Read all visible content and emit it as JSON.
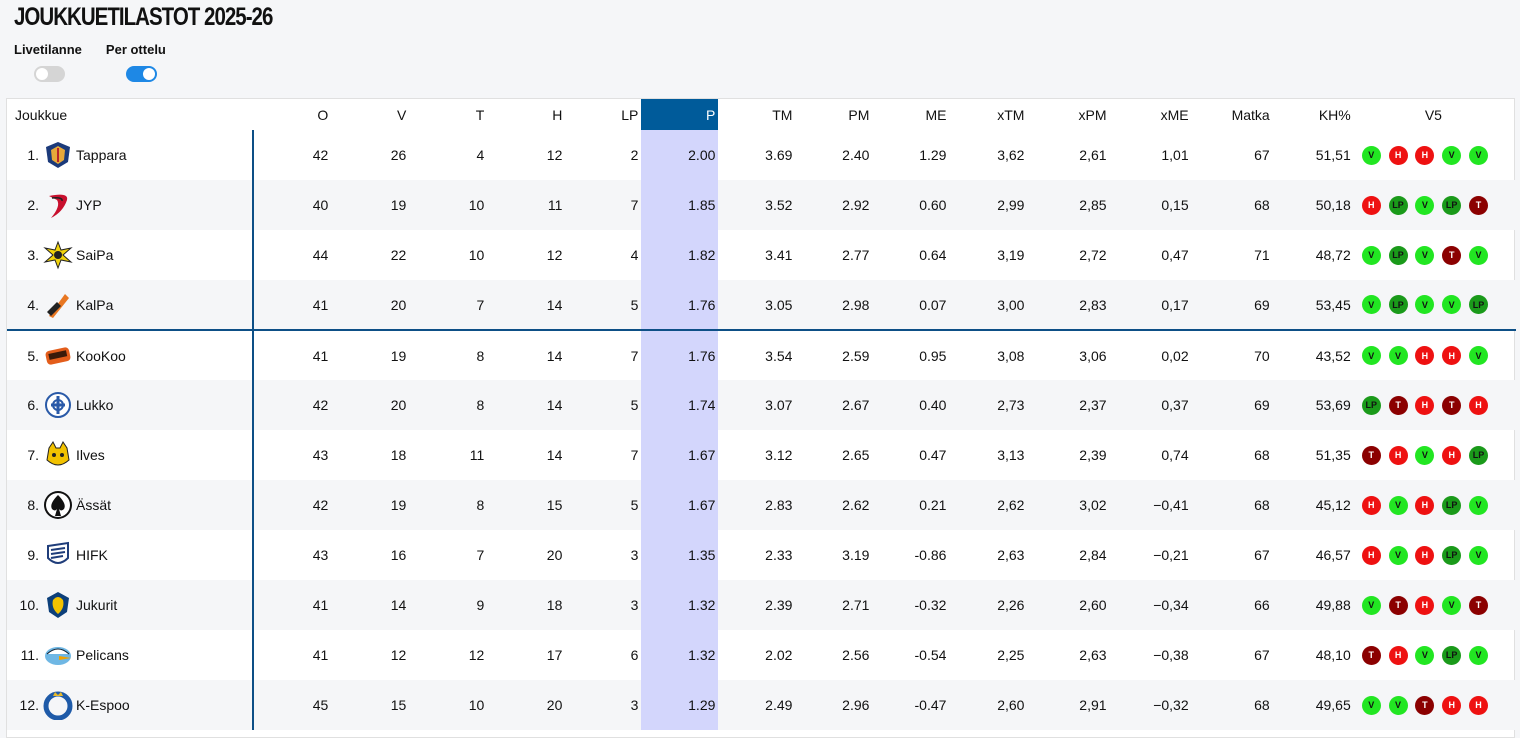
{
  "title": "JOUKKUETILASTOT 2025-26",
  "toggles": [
    {
      "label": "Livetilanne",
      "on": false
    },
    {
      "label": "Per ottelu",
      "on": true
    }
  ],
  "columns": [
    "Joukkue",
    "O",
    "V",
    "T",
    "H",
    "LP",
    "P",
    "TM",
    "PM",
    "ME",
    "xTM",
    "xPM",
    "xME",
    "Matka",
    "KH%",
    "V5"
  ],
  "active_column": "P",
  "rows": [
    {
      "rank": "1.",
      "team": "Tappara",
      "logo": "tappara-logo",
      "O": "42",
      "V": "26",
      "T": "4",
      "H": "12",
      "LP": "2",
      "P": "2.00",
      "TM": "3.69",
      "PM": "2.40",
      "ME": "1.29",
      "xTM": "3,62",
      "xPM": "2,61",
      "xME": "1,01",
      "Matka": "67",
      "KH": "51,51",
      "V5": [
        "V",
        "H",
        "H",
        "V",
        "V"
      ]
    },
    {
      "rank": "2.",
      "team": "JYP",
      "logo": "jyp-logo",
      "O": "40",
      "V": "19",
      "T": "10",
      "H": "11",
      "LP": "7",
      "P": "1.85",
      "TM": "3.52",
      "PM": "2.92",
      "ME": "0.60",
      "xTM": "2,99",
      "xPM": "2,85",
      "xME": "0,15",
      "Matka": "68",
      "KH": "50,18",
      "V5": [
        "H",
        "LP",
        "V",
        "LP",
        "T"
      ]
    },
    {
      "rank": "3.",
      "team": "SaiPa",
      "logo": "saipa-logo",
      "O": "44",
      "V": "22",
      "T": "10",
      "H": "12",
      "LP": "4",
      "P": "1.82",
      "TM": "3.41",
      "PM": "2.77",
      "ME": "0.64",
      "xTM": "3,19",
      "xPM": "2,72",
      "xME": "0,47",
      "Matka": "71",
      "KH": "48,72",
      "V5": [
        "V",
        "LP",
        "V",
        "T",
        "V"
      ]
    },
    {
      "rank": "4.",
      "team": "KalPa",
      "logo": "kalpa-logo",
      "O": "41",
      "V": "20",
      "T": "7",
      "H": "14",
      "LP": "5",
      "P": "1.76",
      "TM": "3.05",
      "PM": "2.98",
      "ME": "0.07",
      "xTM": "3,00",
      "xPM": "2,83",
      "xME": "0,17",
      "Matka": "69",
      "KH": "53,45",
      "V5": [
        "V",
        "LP",
        "V",
        "V",
        "LP"
      ]
    },
    {
      "rank": "5.",
      "team": "KooKoo",
      "logo": "kookoo-logo",
      "O": "41",
      "V": "19",
      "T": "8",
      "H": "14",
      "LP": "7",
      "P": "1.76",
      "TM": "3.54",
      "PM": "2.59",
      "ME": "0.95",
      "xTM": "3,08",
      "xPM": "3,06",
      "xME": "0,02",
      "Matka": "70",
      "KH": "43,52",
      "V5": [
        "V",
        "V",
        "H",
        "H",
        "V"
      ]
    },
    {
      "rank": "6.",
      "team": "Lukko",
      "logo": "lukko-logo",
      "O": "42",
      "V": "20",
      "T": "8",
      "H": "14",
      "LP": "5",
      "P": "1.74",
      "TM": "3.07",
      "PM": "2.67",
      "ME": "0.40",
      "xTM": "2,73",
      "xPM": "2,37",
      "xME": "0,37",
      "Matka": "69",
      "KH": "53,69",
      "V5": [
        "LP",
        "T",
        "H",
        "T",
        "H"
      ]
    },
    {
      "rank": "7.",
      "team": "Ilves",
      "logo": "ilves-logo",
      "O": "43",
      "V": "18",
      "T": "11",
      "H": "14",
      "LP": "7",
      "P": "1.67",
      "TM": "3.12",
      "PM": "2.65",
      "ME": "0.47",
      "xTM": "3,13",
      "xPM": "2,39",
      "xME": "0,74",
      "Matka": "68",
      "KH": "51,35",
      "V5": [
        "T",
        "H",
        "V",
        "H",
        "LP"
      ]
    },
    {
      "rank": "8.",
      "team": "Ässät",
      "logo": "assat-logo",
      "O": "42",
      "V": "19",
      "T": "8",
      "H": "15",
      "LP": "5",
      "P": "1.67",
      "TM": "2.83",
      "PM": "2.62",
      "ME": "0.21",
      "xTM": "2,62",
      "xPM": "3,02",
      "xME": "−0,41",
      "Matka": "68",
      "KH": "45,12",
      "V5": [
        "H",
        "V",
        "H",
        "LP",
        "V"
      ]
    },
    {
      "rank": "9.",
      "team": "HIFK",
      "logo": "hifk-logo",
      "O": "43",
      "V": "16",
      "T": "7",
      "H": "20",
      "LP": "3",
      "P": "1.35",
      "TM": "2.33",
      "PM": "3.19",
      "ME": "-0.86",
      "xTM": "2,63",
      "xPM": "2,84",
      "xME": "−0,21",
      "Matka": "67",
      "KH": "46,57",
      "V5": [
        "H",
        "V",
        "H",
        "LP",
        "V"
      ]
    },
    {
      "rank": "10.",
      "team": "Jukurit",
      "logo": "jukurit-logo",
      "O": "41",
      "V": "14",
      "T": "9",
      "H": "18",
      "LP": "3",
      "P": "1.32",
      "TM": "2.39",
      "PM": "2.71",
      "ME": "-0.32",
      "xTM": "2,26",
      "xPM": "2,60",
      "xME": "−0,34",
      "Matka": "66",
      "KH": "49,88",
      "V5": [
        "V",
        "T",
        "H",
        "V",
        "T"
      ]
    },
    {
      "rank": "11.",
      "team": "Pelicans",
      "logo": "pelicans-logo",
      "O": "41",
      "V": "12",
      "T": "12",
      "H": "17",
      "LP": "6",
      "P": "1.32",
      "TM": "2.02",
      "PM": "2.56",
      "ME": "-0.54",
      "xTM": "2,25",
      "xPM": "2,63",
      "xME": "−0,38",
      "Matka": "67",
      "KH": "48,10",
      "V5": [
        "T",
        "H",
        "V",
        "LP",
        "V"
      ]
    },
    {
      "rank": "12.",
      "team": "K-Espoo",
      "logo": "kespoo-logo",
      "O": "45",
      "V": "15",
      "T": "10",
      "H": "20",
      "LP": "3",
      "P": "1.29",
      "TM": "2.49",
      "PM": "2.96",
      "ME": "-0.47",
      "xTM": "2,60",
      "xPM": "2,91",
      "xME": "−0,32",
      "Matka": "68",
      "KH": "49,65",
      "V5": [
        "V",
        "V",
        "T",
        "H",
        "H"
      ]
    }
  ]
}
